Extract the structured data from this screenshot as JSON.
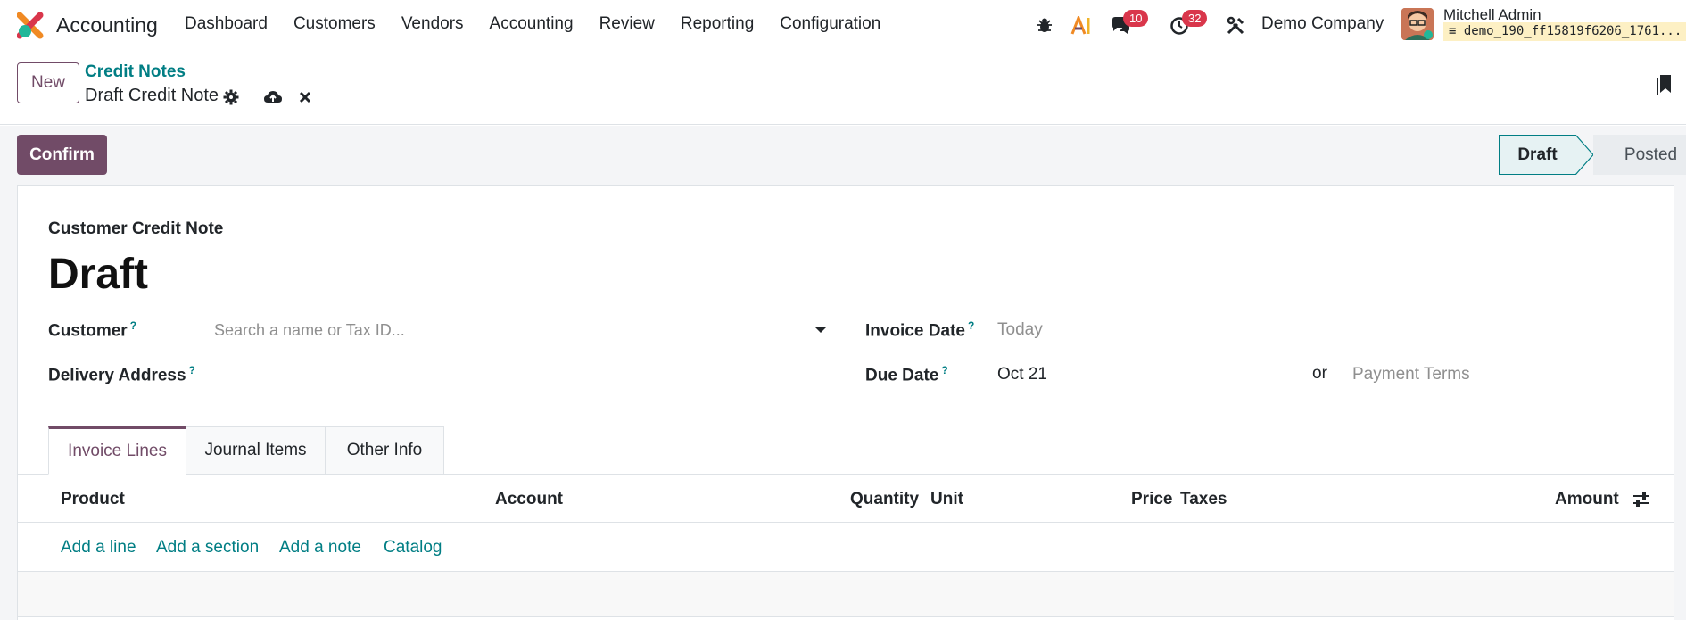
{
  "navbar": {
    "app_name": "Accounting",
    "menu": [
      "Dashboard",
      "Customers",
      "Vendors",
      "Accounting",
      "Review",
      "Reporting",
      "Configuration"
    ],
    "messages_count": "10",
    "activities_count": "32",
    "company": "Demo Company",
    "user_name": "Mitchell Admin",
    "db_name": "demo_190_ff15819f6206_1761..."
  },
  "control_panel": {
    "new_label": "New",
    "breadcrumb": "Credit Notes",
    "record_title": "Draft Credit Note"
  },
  "actions": {
    "confirm_label": "Confirm"
  },
  "statusbar": {
    "stages": [
      "Draft",
      "Posted"
    ],
    "current": "Draft"
  },
  "form": {
    "doc_type": "Customer Credit Note",
    "name": "Draft",
    "customer_label": "Customer",
    "customer_placeholder": "Search a name or Tax ID...",
    "delivery_label": "Delivery Address",
    "invoice_date_label": "Invoice Date",
    "invoice_date_placeholder": "Today",
    "due_date_label": "Due Date",
    "due_date_value": "Oct 21",
    "or_text": "or",
    "payment_terms_placeholder": "Payment Terms",
    "help_mark": "?"
  },
  "tabs": [
    "Invoice Lines",
    "Journal Items",
    "Other Info"
  ],
  "table": {
    "columns": [
      "Product",
      "Account",
      "Quantity",
      "Unit",
      "Price",
      "Taxes",
      "Amount"
    ],
    "add_links": [
      "Add a line",
      "Add a section",
      "Add a note",
      "Catalog"
    ]
  },
  "colors": {
    "brand": "#714b67",
    "accent": "#017e84",
    "badge": "#d9364b"
  }
}
